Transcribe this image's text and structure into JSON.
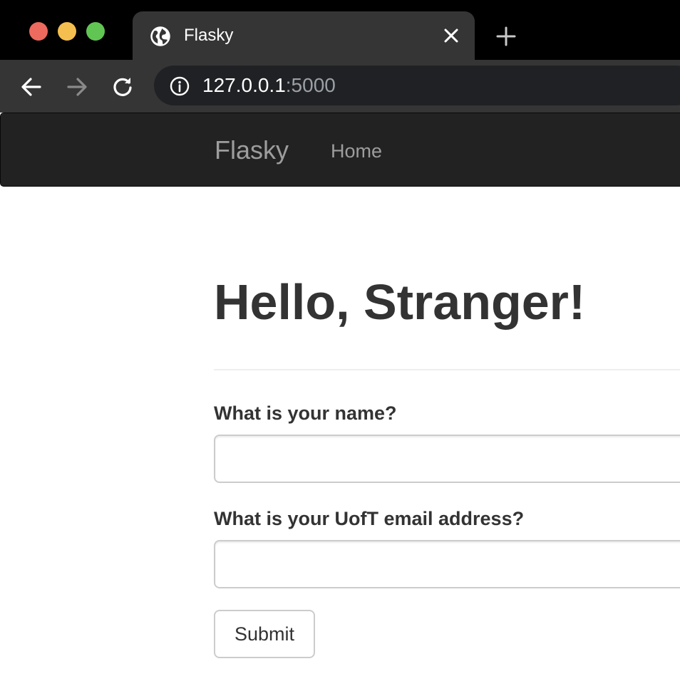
{
  "browser": {
    "tab": {
      "title": "Flasky",
      "favicon": "globe-icon"
    },
    "new_tab_icon": "plus-icon",
    "close_tab_icon": "close-icon",
    "navigation": {
      "back_icon": "arrow-left-icon",
      "forward_icon": "arrow-right-icon",
      "reload_icon": "reload-icon"
    },
    "address_bar": {
      "info_icon": "info-icon",
      "host": "127.0.0.1",
      "port": ":5000"
    },
    "window_controls": {
      "close_color": "#ed6a5e",
      "minimize_color": "#f5bf4f",
      "zoom_color": "#61c554"
    }
  },
  "navbar": {
    "brand": "Flasky",
    "links": [
      {
        "label": "Home"
      }
    ]
  },
  "page": {
    "heading": "Hello, Stranger!",
    "form": {
      "name_label": "What is your name?",
      "name_value": "",
      "email_label": "What is your UofT email address?",
      "email_value": "",
      "submit_label": "Submit"
    }
  },
  "colors": {
    "navbar_background": "#222222",
    "navbar_text": "#9d9d9d",
    "heading_text": "#333333",
    "input_border": "#cccccc"
  }
}
